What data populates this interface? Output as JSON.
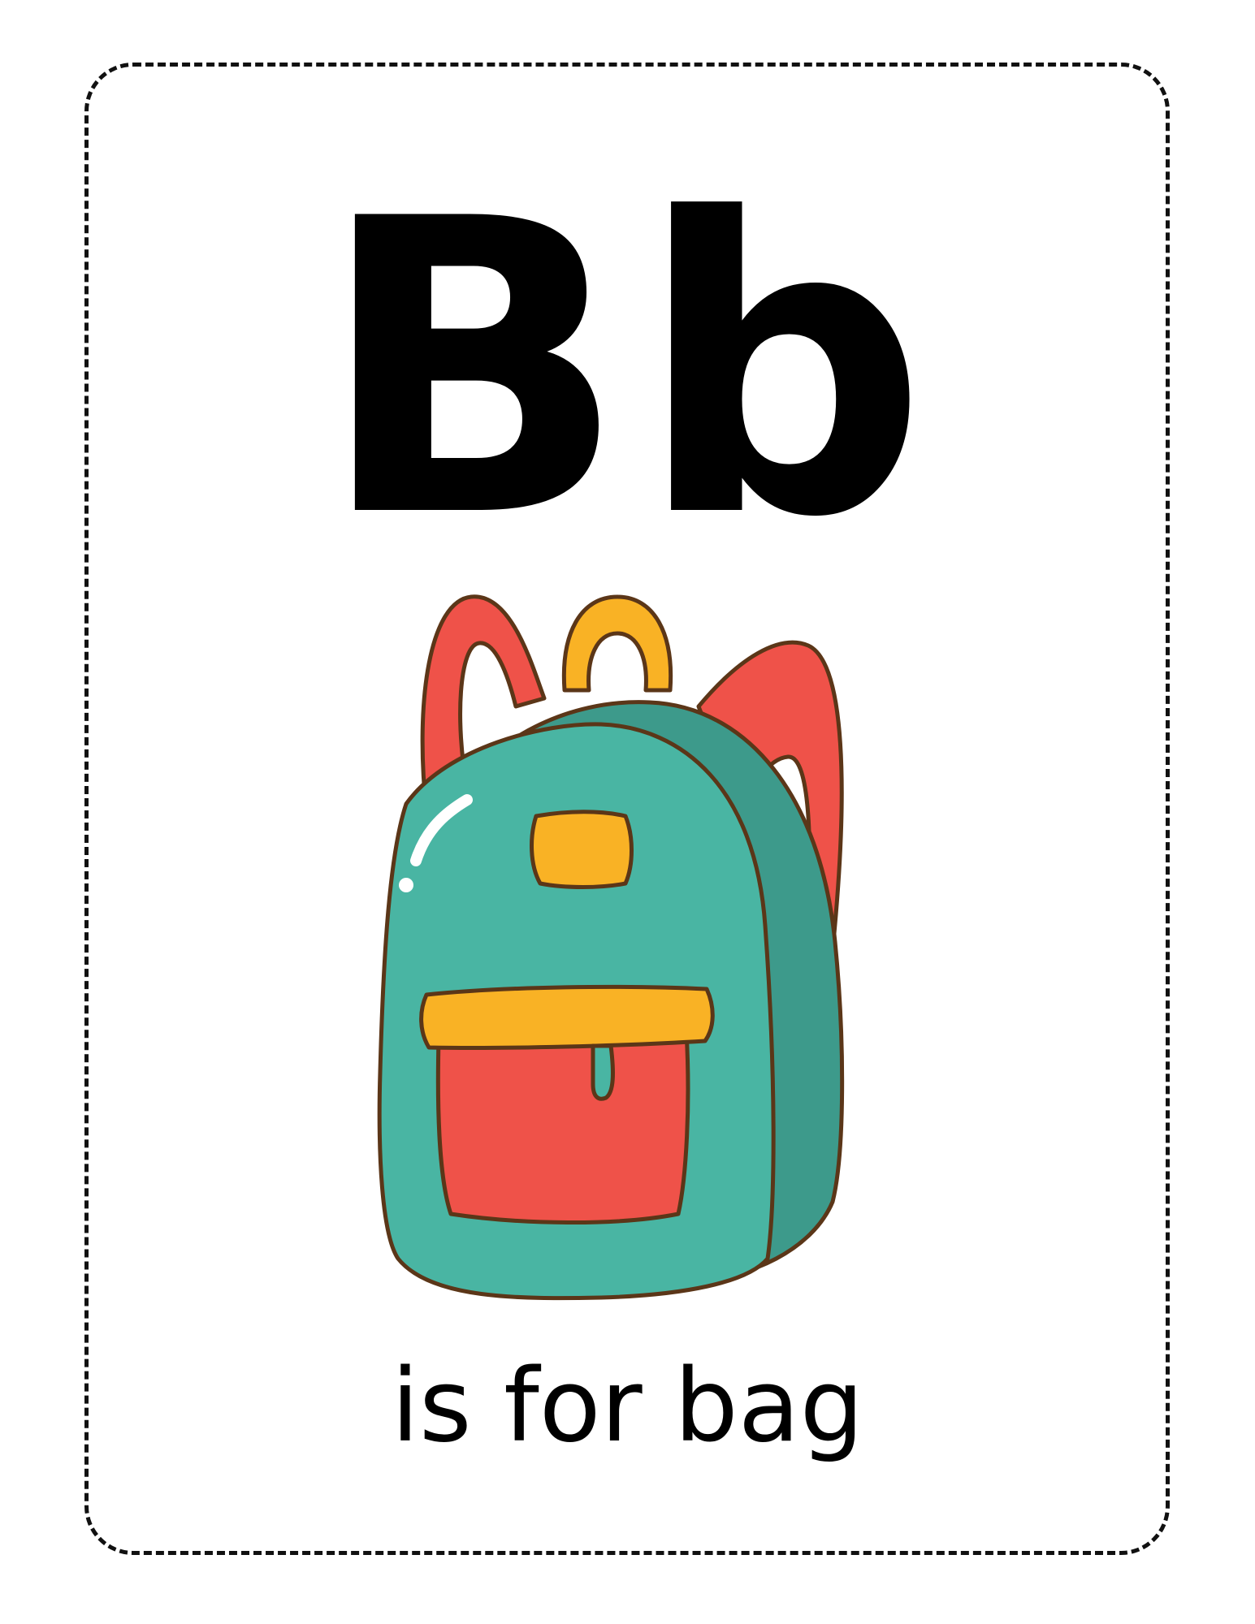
{
  "card": {
    "letter": "Bb",
    "caption": "is for bag",
    "illustration": {
      "icon": "backpack-icon",
      "colors": {
        "body": "#49b5a3",
        "body_shade": "#3d9a8b",
        "straps": "#ef5249",
        "straps_shade": "#e1342c",
        "handle": "#f9b225",
        "handle_shade": "#f59d1f",
        "pocket": "#ef5249",
        "pocket_flap": "#f9b225",
        "outline": "#5b3618"
      }
    }
  }
}
